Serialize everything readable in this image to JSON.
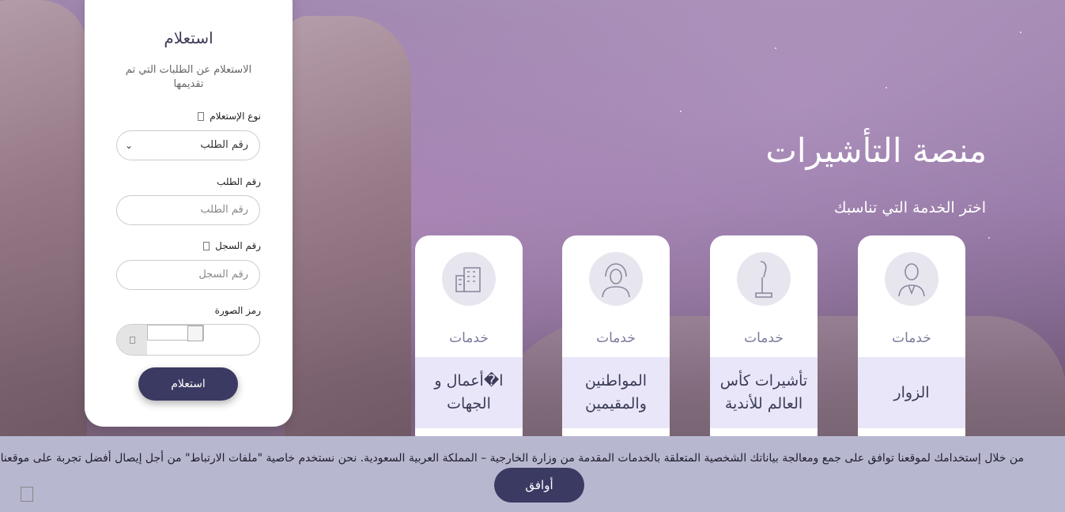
{
  "hero": {
    "title": "منصة التأشيرات",
    "subtitle": "اختر الخدمة التي تناسبك"
  },
  "inquiry": {
    "title": "استعلام",
    "subtitle": "الاستعلام عن الطلبات التي تم تقديمها",
    "type_label": "نوع الإستعلام",
    "type_selected": "رقم الطلب",
    "request_label": "رقم الطلب",
    "request_placeholder": "رقم الطلب",
    "record_label": "رقم السجل",
    "record_placeholder": "رقم السجل",
    "captcha_label": "رمز الصورة",
    "submit": "استعلام"
  },
  "services": [
    {
      "icon": "person-suit-icon",
      "category": "خدمات",
      "name": "الزوار"
    },
    {
      "icon": "trophy-icon",
      "category": "خدمات",
      "name": "تأشيرات كأس العالم للأندية"
    },
    {
      "icon": "saudi-man-icon",
      "category": "خدمات",
      "name": "المواطنين والمقيمين"
    },
    {
      "icon": "building-icon",
      "category": "خدمات",
      "name": "ا�أعمال و الجهات"
    }
  ],
  "cookie": {
    "text": "من خلال إستخدامك لموقعنا توافق على جمع ومعالجة بياناتك الشخصية المتعلقة بالخدمات المقدمة من وزارة الخارجية – المملكة العربية السعودية. نحن نستخدم خاصية \"ملفات الارتباط\" من أجل إيصال أفضل تجربة على موقعنا.",
    "accept": "أوافق"
  },
  "colors": {
    "primary": "#3b3a63",
    "card_band": "#e8e6f8",
    "cookie_bg": "#b8b7d0"
  }
}
